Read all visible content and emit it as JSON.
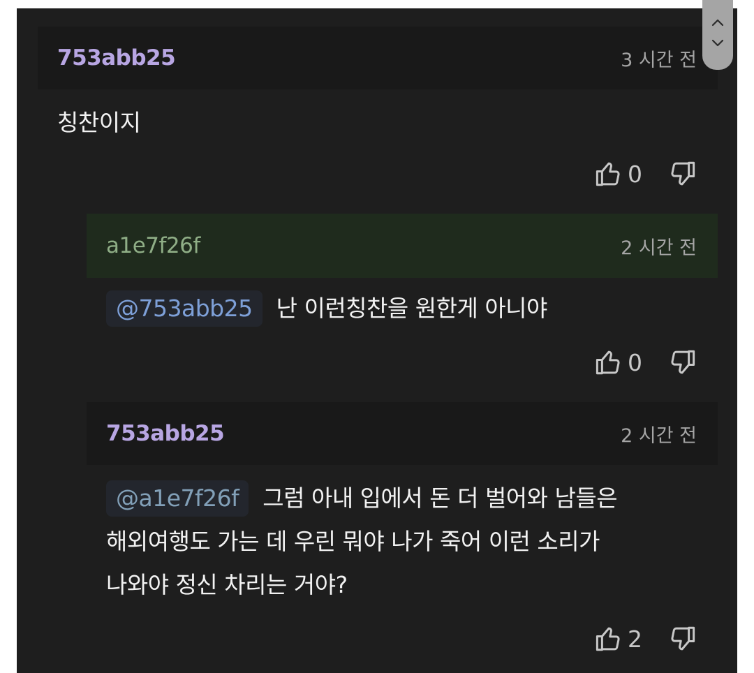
{
  "comments": [
    {
      "author": "753abb25",
      "time": "3 시간 전",
      "mention": "",
      "lines": [
        "칭찬이지"
      ],
      "likes": "0"
    },
    {
      "author": "a1e7f26f",
      "time": "2 시간 전",
      "mention": "@753abb25",
      "lines": [
        "난 이런칭찬을 원한게 아니야"
      ],
      "likes": "0"
    },
    {
      "author": "753abb25",
      "time": "2 시간 전",
      "mention": "@a1e7f26f",
      "lines": [
        "그럼 아내 입에서 돈 더 벌어와 남들은",
        "해외여행도 가는 데 우린 뭐야 나가 죽어 이런 소리가",
        "나와야 정신 차리는 거야?"
      ],
      "likes": "2"
    }
  ],
  "icons": {
    "like": "thumbs-up-icon",
    "dislike": "thumbs-down-icon",
    "scroll_up": "chevron-up-icon",
    "scroll_down": "chevron-down-icon"
  },
  "colors": {
    "background": "#1e1e1e",
    "author_purple": "#b8a6e3",
    "author_green": "#8fae86",
    "highlight_header": "#1f2b1d",
    "mention": "#7ea0d8"
  }
}
